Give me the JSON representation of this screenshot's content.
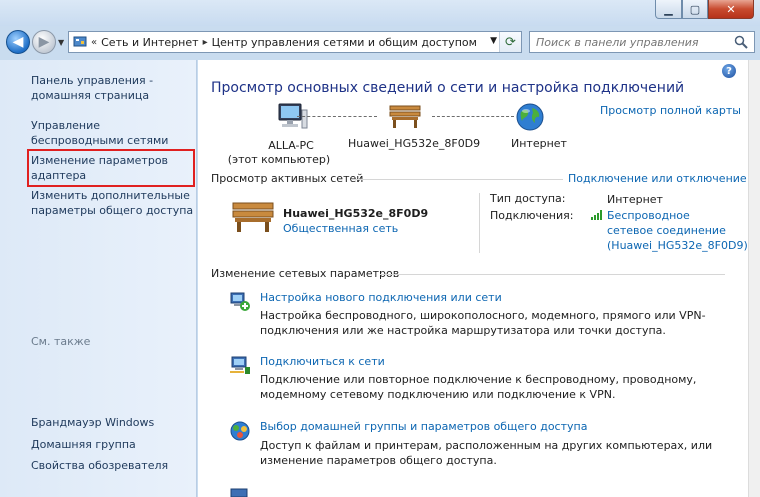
{
  "window": {
    "minimize": "▁",
    "maximize": "▢",
    "close": "✕"
  },
  "address": {
    "sep": "«",
    "crumb1": "Сеть и Интернет",
    "crumb2": "Центр управления сетями и общим доступом",
    "arrow": "▸"
  },
  "search": {
    "placeholder": "Поиск в панели управления"
  },
  "sidebar": {
    "items": [
      {
        "label": "Панель управления - домашняя страница"
      },
      {
        "label": "Управление беспроводными сетями"
      },
      {
        "label": "Изменение параметров адаптера"
      },
      {
        "label": "Изменить дополнительные параметры общего доступа"
      }
    ],
    "see_also": "См. также",
    "bottom": [
      {
        "label": "Брандмауэр Windows"
      },
      {
        "label": "Домашняя группа"
      },
      {
        "label": "Свойства обозревателя"
      }
    ]
  },
  "main": {
    "title": "Просмотр основных сведений о сети и настройка подключений",
    "full_map": "Просмотр полной карты",
    "map": {
      "pc_name": "ALLA-PC",
      "pc_sub": "(этот компьютер)",
      "router": "Huawei_HG532e_8F0D9",
      "internet": "Интернет"
    },
    "active_header": "Просмотр активных сетей",
    "connect_disconnect": "Подключение или отключение",
    "active": {
      "name": "Huawei_HG532e_8F0D9",
      "type": "Общественная сеть",
      "access_label": "Тип доступа:",
      "access_value": "Интернет",
      "conn_label": "Подключения:",
      "conn_value": "Беспроводное сетевое соединение (Huawei_HG532e_8F0D9)"
    },
    "change_header": "Изменение сетевых параметров",
    "tasks": [
      {
        "title": "Настройка нового подключения или сети",
        "desc": "Настройка беспроводного, широкополосного, модемного, прямого или VPN-подключения или же настройка маршрутизатора или точки доступа."
      },
      {
        "title": "Подключиться к сети",
        "desc": "Подключение или повторное подключение к беспроводному, проводному, модемному сетевому подключению или подключение к VPN."
      },
      {
        "title": "Выбор домашней группы и параметров общего доступа",
        "desc": "Доступ к файлам и принтерам, расположенным на других компьютерах, или изменение параметров общего доступа."
      }
    ]
  },
  "colors": {
    "link": "#0c66b2",
    "title": "#1e3287",
    "highlight": "#e02020"
  }
}
